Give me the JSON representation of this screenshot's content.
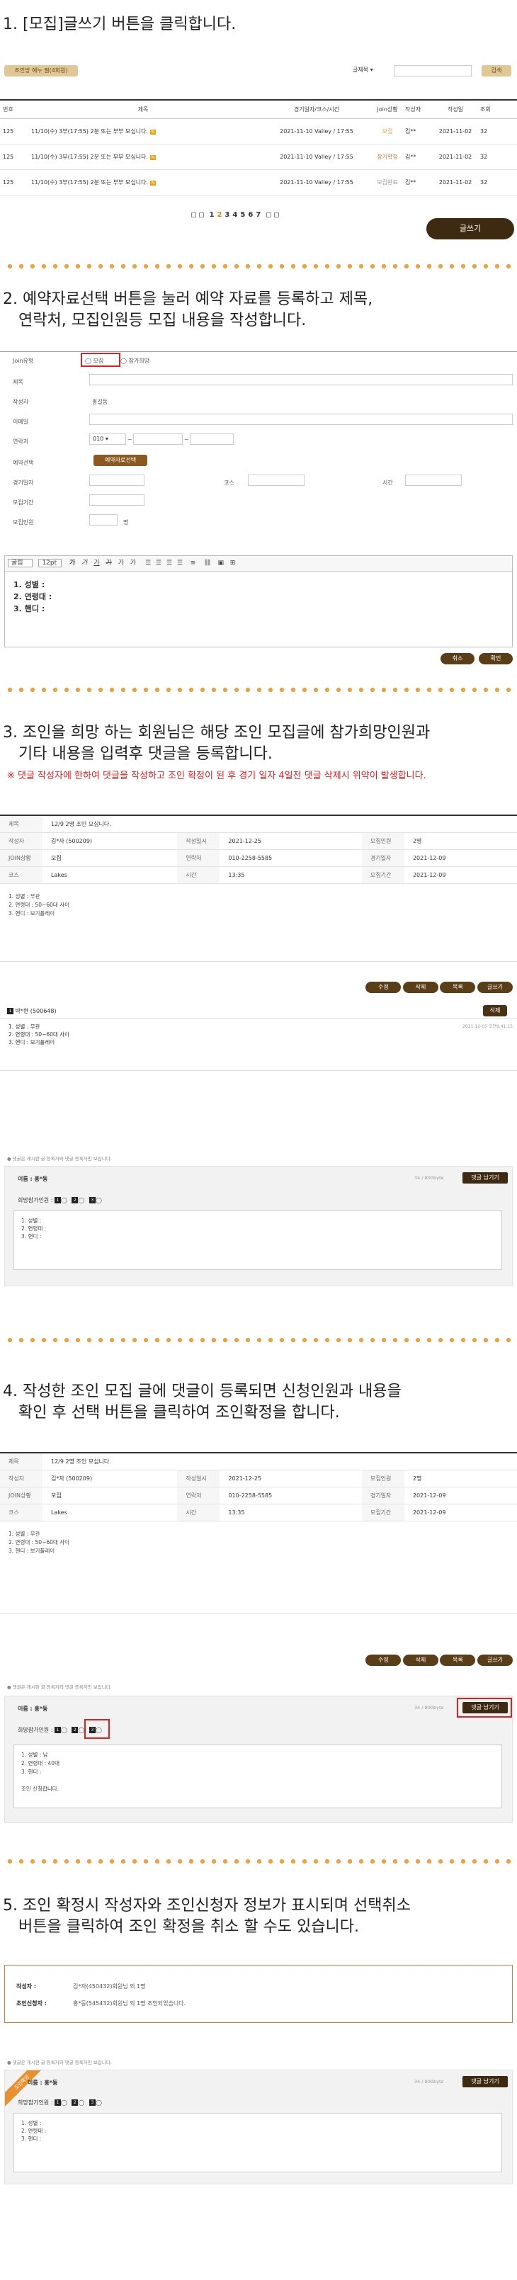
{
  "steps": [
    {
      "num": "1.",
      "title": "[모집]글쓰기 버튼을 클릭합니다."
    },
    {
      "num": "2.",
      "line1": "예약자료선택 버튼을 눌러 예약 자료를 등록하고 제목,",
      "line2": "연락처, 모집인원등 모집 내용을 작성합니다."
    },
    {
      "num": "3.",
      "line1": "조인을 희망 하는 회원님은 해당 조인 모집글에 참가희망인원과",
      "line2": "기타 내용을 입력후 댓글을 등록합니다.",
      "warning": "※ 댓글 작성자에 한하여 댓글을 작성하고 조인 확정이 된 후 경기 일자 4일전 댓글 삭제시 위약이 발생합니다."
    },
    {
      "num": "4.",
      "line1": "작성한 조인 모집 글에 댓글이 등록되면 신청인원과 내용을",
      "line2": "확인 후 선택 버튼을 클릭하여 조인확정을 합니다."
    },
    {
      "num": "5.",
      "line1": "조인 확정시 작성자와 조인신청자 정보가 표시되며 선택취소",
      "line2": "버튼을 클릭하여 조인 확정을 취소 할 수도 있습니다."
    }
  ],
  "list": {
    "filter_btn": "조인방 예누 필(4회원)",
    "search_select": "글제목",
    "search_btn": "검색",
    "headers": [
      "번호",
      "제목",
      "경기일자/코스/시간",
      "Join상황",
      "작성자",
      "작성일",
      "조회"
    ],
    "rows": [
      {
        "no": "125",
        "title": "11/10(수) 3부(17:55) 2분 또는 부부 모십니다.",
        "info": "2021-11-10 Valley / 17:55",
        "status": "모집",
        "author": "김**",
        "date": "2021-11-02",
        "views": "32"
      },
      {
        "no": "125",
        "title": "11/10(수) 3부(17:55) 2분 또는 부부 모십니다.",
        "info": "2021-11-10 Valley / 17:55",
        "status": "참가확정",
        "author": "김**",
        "date": "2021-11-02",
        "views": "32"
      },
      {
        "no": "125",
        "title": "11/10(수) 3부(17:55) 2분 또는 부부 모십니다.",
        "info": "2021-11-10 Valley / 17:55",
        "status": "모집완료",
        "author": "김**",
        "date": "2021-11-02",
        "views": "32"
      }
    ],
    "pages": [
      "1",
      "2",
      "3",
      "4",
      "5",
      "6",
      "7"
    ],
    "write_btn": "글쓰기"
  },
  "form": {
    "labels": [
      "Join유형",
      "제목",
      "작성자",
      "이메일",
      "연락처",
      "예약선택",
      "경기일자",
      "모집기간",
      "모집인원"
    ],
    "radio1": "모집",
    "radio2": "참가희망",
    "author": "홍길동",
    "phone_prefix": "010",
    "reserve_btn": "예약자료선택",
    "course_label": "코스",
    "time_label": "시간",
    "people_unit": "명",
    "font": "굴림",
    "size": "12pt",
    "body_lines": [
      "1. 성별 :",
      "2. 연령대 :",
      "3. 핸디 :"
    ],
    "cancel": "취소",
    "ok": "확인"
  },
  "detail": {
    "title_label": "제목",
    "title": "12/9 2명 조인 모십니다.",
    "rows": [
      [
        [
          "작성자",
          "김*자 (500209)"
        ],
        [
          "작성일시",
          "2021-12-25"
        ],
        [
          "모집인원",
          "2명"
        ]
      ],
      [
        [
          "JOIN상황",
          "모집"
        ],
        [
          "연락처",
          "010-2258-5585"
        ],
        [
          "경기일자",
          "2021-12-09"
        ]
      ],
      [
        [
          "코스",
          "Lakes"
        ],
        [
          "시간",
          "13:35"
        ],
        [
          "모집기간",
          "2021-12-09"
        ]
      ]
    ],
    "body": [
      "1. 성별 : 무관",
      "2. 연령대 : 50~60대 사이",
      "3. 핸디 : 보기플레이"
    ],
    "btns": [
      "수정",
      "삭제",
      "목록",
      "글쓰기"
    ]
  },
  "comment": {
    "num": "1",
    "name": "박*현 (500648)",
    "del": "삭제",
    "date": "2021-12-05 오전9:41:15",
    "lines": [
      "1. 성별 : 무관",
      "2. 연령대 : 50~60대 사이",
      "3. 핸디 : 보기플레이"
    ]
  },
  "reply": {
    "note": "● 댓글은 게시판 글 등록자와 댓글 등록자만 보입니다.",
    "name_label": "이름 : 홍*동",
    "count": "34 / 800byte",
    "save": "댓글 남기기",
    "people_label": "희망참가인원 :",
    "opts": [
      "1",
      "2",
      "3"
    ],
    "lines": [
      "1. 성별 :",
      "2. 연령대 :",
      "3. 핸디 :"
    ],
    "lines4": [
      "1. 성별 : 남",
      "2. 연령대 : 40대",
      "3. 핸디 :",
      "",
      "조인 신청합니다."
    ]
  },
  "confirm": {
    "author_label": "작성자 :",
    "author": "김*자(450432)회원님 외 1명",
    "joiner_label": "조인신청자 :",
    "joiner": "홍*동(545432)회원님 외 1명 조인되었습니다.",
    "ribbon": "조인확정"
  }
}
